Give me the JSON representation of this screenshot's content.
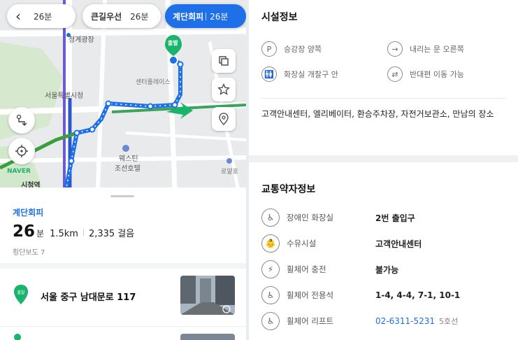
{
  "header_tabs": {
    "back_time": "26분",
    "tab2_name": "큰길우선",
    "tab2_time": "26분",
    "tab3_name": "계단회피",
    "tab3_time": "26분"
  },
  "map": {
    "labels": {
      "plaza": "청계광장",
      "city": "서울특별시청",
      "center": "센터플레이스",
      "hotel1": "웨스틴",
      "hotel2": "조선호텔",
      "royal": "로얄호",
      "city_hall_station": "시청역",
      "naver": "NAVER",
      "start_badge": "출발"
    },
    "buttons": [
      "layers-icon",
      "star-icon",
      "pin-icon",
      "route-icon",
      "location-icon"
    ]
  },
  "route_summary": {
    "type": "계단회피",
    "minutes": "26",
    "minutes_unit": "분",
    "distance": "1.5km",
    "steps": "2,335 걸음",
    "crosswalk": "횡단보도 7"
  },
  "destination": {
    "badge": "출발",
    "address": "서울 중구 남대문로 117"
  },
  "facility": {
    "title": "시설정보",
    "items": [
      {
        "icon": "P",
        "label": "승강장 양쪽"
      },
      {
        "icon": "→",
        "label": "내리는 문 오른쪽"
      },
      {
        "icon": "🚻",
        "label": "화장실 개찰구 안"
      },
      {
        "icon": "⇄",
        "label": "반대편 이동 가능"
      }
    ],
    "amenities": "고객안내센터, 엘리베이터, 환승주차장, 자전거보관소, 만남의 장소"
  },
  "accessibility": {
    "title": "교통약자정보",
    "rows": [
      {
        "icon": "♿",
        "label": "장애인 화장실",
        "value": "2번 출입구"
      },
      {
        "icon": "👶",
        "label": "수유시설",
        "value": "고객안내센터"
      },
      {
        "icon": "⚡",
        "label": "휠체어 충전",
        "value": "불가능"
      },
      {
        "icon": "♿",
        "label": "휠체어 전용석",
        "value": "1-4, 4-4, 7-1, 10-1"
      },
      {
        "icon": "♿",
        "label": "휠체어 리프트",
        "value": "02-6311-5231",
        "suffix": "5호선"
      }
    ]
  },
  "colors": {
    "accent": "#1e6fe8",
    "route": "#1e6fe8",
    "start_green": "#19b46b"
  }
}
